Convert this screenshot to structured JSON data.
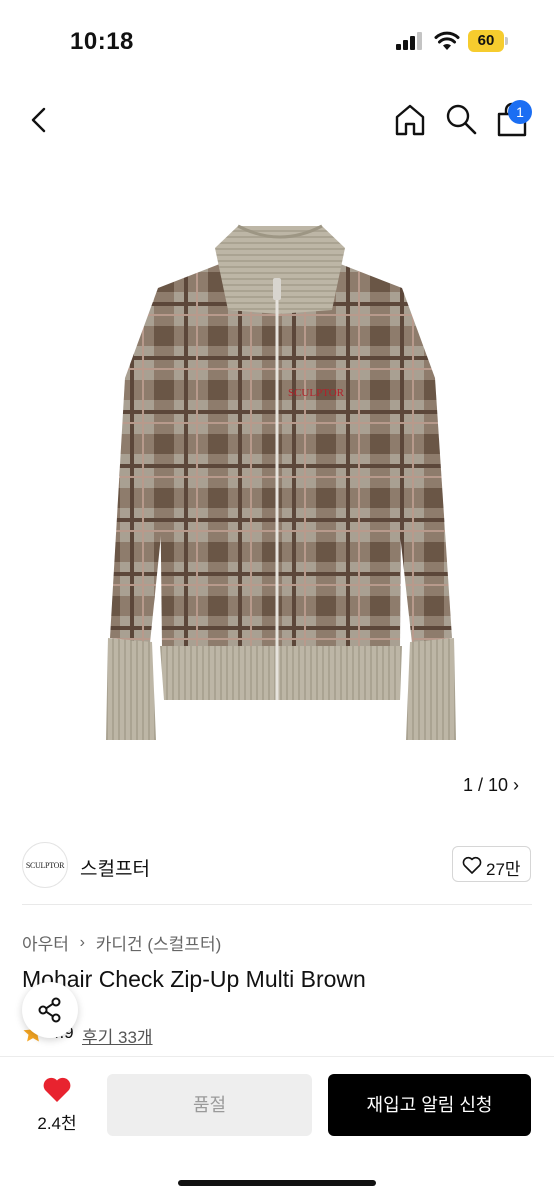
{
  "status_bar": {
    "time": "10:18",
    "battery": "60"
  },
  "nav": {
    "cart_count": "1"
  },
  "gallery": {
    "pager": "1 / 10",
    "logo_print": "SCULPTOR"
  },
  "brand": {
    "logo_text": "SCULPTOR",
    "name": "스컬프터",
    "like_count": "27만"
  },
  "breadcrumb": {
    "level1": "아우터",
    "separator": "›",
    "level2": "카디건 (스컬프터)"
  },
  "product": {
    "title": "Mohair Check Zip-Up Multi Brown",
    "rating": "4.9",
    "reviews": "후기 33개"
  },
  "actions": {
    "wish_count": "2.4천",
    "soldout_label": "품절",
    "restock_label": "재입고 알림 신청"
  },
  "colors": {
    "accent_blue": "#1b6ef3",
    "heart_red": "#e8232f",
    "star_orange": "#f5a623",
    "battery_yellow": "#f6cc2e"
  },
  "icons": [
    "back-icon",
    "home-icon",
    "search-icon",
    "cart-icon",
    "heart-outline-icon",
    "share-icon",
    "star-icon",
    "heart-filled-icon"
  ]
}
